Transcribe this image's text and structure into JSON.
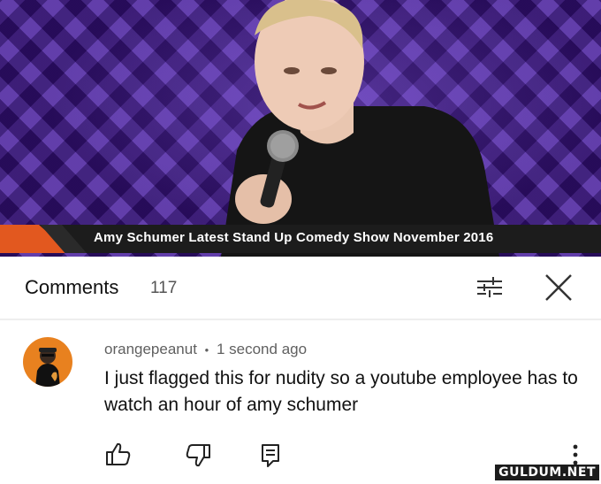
{
  "video": {
    "caption": "Amy Schumer Latest Stand Up Comedy Show November 2016"
  },
  "comments": {
    "title": "Comments",
    "count": "117"
  },
  "comment": {
    "author": "orangepeanut",
    "separator": "•",
    "time": "1 second ago",
    "text": "I just flagged this for nudity so a youtube employee has to watch an hour of amy schumer"
  },
  "icons": {
    "filter": "sort-filter-icon",
    "close": "close-icon",
    "like": "thumbs-up-icon",
    "dislike": "thumbs-down-icon",
    "reply": "reply-icon",
    "more": "more-vert-icon"
  },
  "watermark": "GULDUM.NET"
}
